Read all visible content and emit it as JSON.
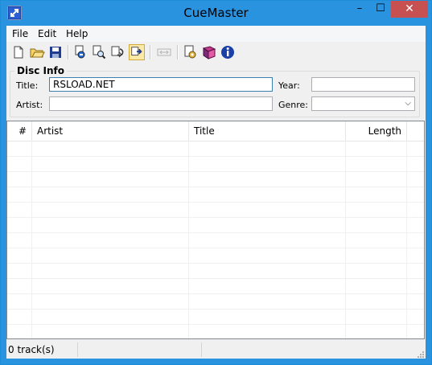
{
  "window": {
    "title": "CueMaster",
    "minimize_glyph": "–",
    "maximize_glyph": "☐",
    "close_glyph": "✕",
    "accent_color": "#2a93df"
  },
  "menu": {
    "items": [
      {
        "label": "File"
      },
      {
        "label": "Edit"
      },
      {
        "label": "Help"
      }
    ]
  },
  "toolbar": {
    "buttons": [
      {
        "icon": "new-document-icon"
      },
      {
        "icon": "open-folder-icon"
      },
      {
        "icon": "save-disk-icon"
      },
      {
        "icon": "import-icon"
      },
      {
        "icon": "find-icon"
      },
      {
        "icon": "lookup-icon"
      },
      {
        "icon": "lookup-active-icon",
        "active": true
      },
      {
        "icon": "split-icon",
        "disabled": true
      },
      {
        "icon": "settings-icon"
      },
      {
        "icon": "book-icon"
      },
      {
        "icon": "info-icon"
      }
    ]
  },
  "disc_info": {
    "group_title": "Disc Info",
    "title_label": "Title:",
    "title_value": "RSLOAD.NET",
    "artist_label": "Artist:",
    "artist_value": "",
    "year_label": "Year:",
    "year_value": "",
    "genre_label": "Genre:",
    "genre_value": ""
  },
  "tracklist": {
    "columns": [
      "#",
      "Artist",
      "Title",
      "Length"
    ],
    "rows": []
  },
  "status": {
    "track_count": "0 track(s)"
  }
}
